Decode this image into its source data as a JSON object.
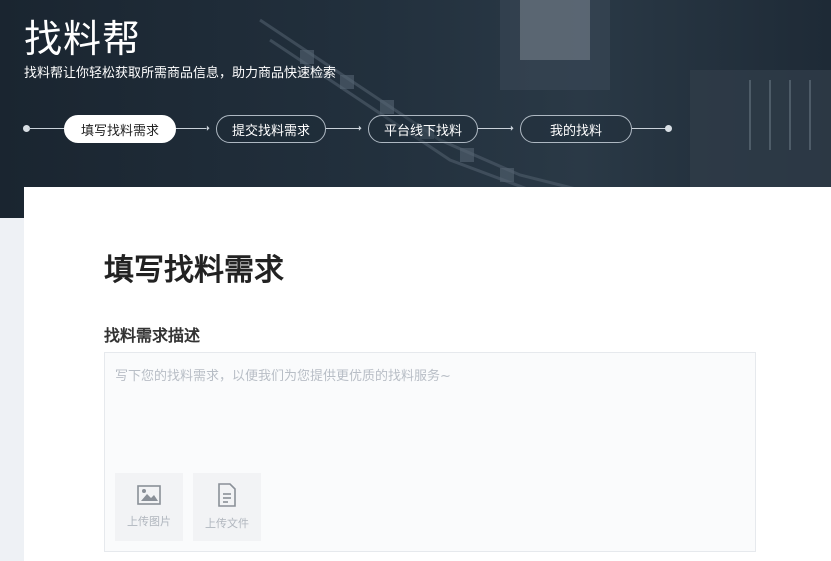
{
  "header": {
    "brand_title": "找料帮",
    "brand_subtitle": "找料帮让你轻松获取所需商品信息，助力商品快速检索"
  },
  "steps": [
    {
      "label": "填写找料需求",
      "active": true
    },
    {
      "label": "提交找料需求",
      "active": false
    },
    {
      "label": "平台线下找料",
      "active": false
    },
    {
      "label": "我的找料",
      "active": false
    }
  ],
  "form": {
    "page_title": "填写找料需求",
    "section_label": "找料需求描述",
    "description_placeholder": "写下您的找料需求，以便我们为您提供更优质的找料服务~",
    "description_value": "",
    "upload_image_label": "上传图片",
    "upload_file_label": "上传文件"
  },
  "colors": {
    "banner_bg": "#1e2a36",
    "active_step_bg": "#ffffff",
    "placeholder": "#b8bec6"
  },
  "icons": {
    "upload_image": "image-icon",
    "upload_file": "document-icon"
  }
}
